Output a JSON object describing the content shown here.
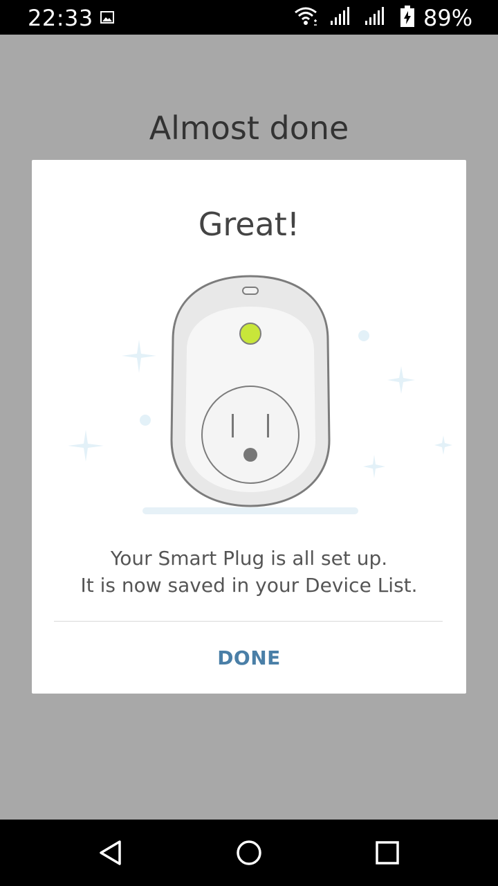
{
  "status_bar": {
    "time": "22:33",
    "battery": "89%",
    "icons": [
      "image-notification-icon",
      "wifi-icon",
      "signal-icon",
      "signal-icon",
      "battery-charging-icon"
    ]
  },
  "page": {
    "title": "Almost done"
  },
  "dialog": {
    "title": "Great!",
    "message_line1": "Your Smart Plug is all set up.",
    "message_line2": "It is now saved in your Device List.",
    "done_label": "DONE",
    "illustration": "smart-plug-illustration",
    "colors": {
      "accent": "#4a7fa7",
      "led": "#c8e63a",
      "sparkle": "#e3f1f8"
    }
  },
  "nav_bar": {
    "icons": [
      "back-icon",
      "home-icon",
      "recents-icon"
    ]
  }
}
